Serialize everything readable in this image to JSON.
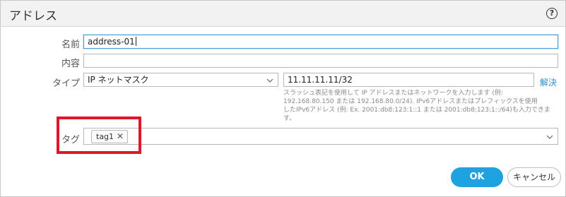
{
  "dialog": {
    "title": "アドレス",
    "help_glyph": "?"
  },
  "form": {
    "name": {
      "label": "名前",
      "value": "address-01"
    },
    "description": {
      "label": "内容",
      "value": ""
    },
    "type": {
      "label": "タイプ",
      "selected": "IP ネットマスク",
      "address_value": "11.11.11.11/32",
      "resolve_link": "解決",
      "help_lines": [
        "スラッシュ表記を使用して IP アドレスまたはネットワークを入力します (例:",
        "192.168.80.150 または 192.168.80.0/24). IPv6アドレスまたはプレフィックスを使用",
        "したIPv6アドレス (例: Ex. 2001:db8:123:1::1 または 2001:db8:123:1::/64)も入力できま",
        "す。"
      ]
    },
    "tags": {
      "label": "タグ",
      "items": [
        {
          "label": "tag1",
          "remove_glyph": "✕"
        }
      ]
    }
  },
  "buttons": {
    "ok": "OK",
    "cancel": "キャンセル"
  },
  "icons": {
    "help": "help-icon",
    "dropdown": "chevron-down-icon",
    "remove": "close-icon"
  },
  "colors": {
    "primary_button": "#1ea3e0",
    "link": "#2a8fcf",
    "highlight_box": "#e0162b",
    "focus_border": "#4a9fd6"
  }
}
